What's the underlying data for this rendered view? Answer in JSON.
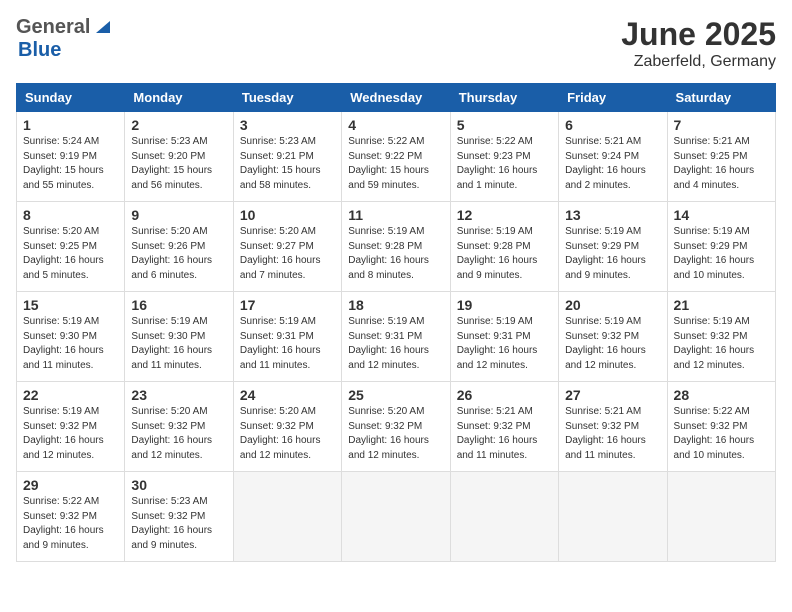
{
  "logo": {
    "general": "General",
    "blue": "Blue"
  },
  "title": "June 2025",
  "subtitle": "Zaberfeld, Germany",
  "days": [
    "Sunday",
    "Monday",
    "Tuesday",
    "Wednesday",
    "Thursday",
    "Friday",
    "Saturday"
  ],
  "weeks": [
    [
      {
        "num": "1",
        "info": "Sunrise: 5:24 AM\nSunset: 9:19 PM\nDaylight: 15 hours\nand 55 minutes."
      },
      {
        "num": "2",
        "info": "Sunrise: 5:23 AM\nSunset: 9:20 PM\nDaylight: 15 hours\nand 56 minutes."
      },
      {
        "num": "3",
        "info": "Sunrise: 5:23 AM\nSunset: 9:21 PM\nDaylight: 15 hours\nand 58 minutes."
      },
      {
        "num": "4",
        "info": "Sunrise: 5:22 AM\nSunset: 9:22 PM\nDaylight: 15 hours\nand 59 minutes."
      },
      {
        "num": "5",
        "info": "Sunrise: 5:22 AM\nSunset: 9:23 PM\nDaylight: 16 hours\nand 1 minute."
      },
      {
        "num": "6",
        "info": "Sunrise: 5:21 AM\nSunset: 9:24 PM\nDaylight: 16 hours\nand 2 minutes."
      },
      {
        "num": "7",
        "info": "Sunrise: 5:21 AM\nSunset: 9:25 PM\nDaylight: 16 hours\nand 4 minutes."
      }
    ],
    [
      {
        "num": "8",
        "info": "Sunrise: 5:20 AM\nSunset: 9:25 PM\nDaylight: 16 hours\nand 5 minutes."
      },
      {
        "num": "9",
        "info": "Sunrise: 5:20 AM\nSunset: 9:26 PM\nDaylight: 16 hours\nand 6 minutes."
      },
      {
        "num": "10",
        "info": "Sunrise: 5:20 AM\nSunset: 9:27 PM\nDaylight: 16 hours\nand 7 minutes."
      },
      {
        "num": "11",
        "info": "Sunrise: 5:19 AM\nSunset: 9:28 PM\nDaylight: 16 hours\nand 8 minutes."
      },
      {
        "num": "12",
        "info": "Sunrise: 5:19 AM\nSunset: 9:28 PM\nDaylight: 16 hours\nand 9 minutes."
      },
      {
        "num": "13",
        "info": "Sunrise: 5:19 AM\nSunset: 9:29 PM\nDaylight: 16 hours\nand 9 minutes."
      },
      {
        "num": "14",
        "info": "Sunrise: 5:19 AM\nSunset: 9:29 PM\nDaylight: 16 hours\nand 10 minutes."
      }
    ],
    [
      {
        "num": "15",
        "info": "Sunrise: 5:19 AM\nSunset: 9:30 PM\nDaylight: 16 hours\nand 11 minutes."
      },
      {
        "num": "16",
        "info": "Sunrise: 5:19 AM\nSunset: 9:30 PM\nDaylight: 16 hours\nand 11 minutes."
      },
      {
        "num": "17",
        "info": "Sunrise: 5:19 AM\nSunset: 9:31 PM\nDaylight: 16 hours\nand 11 minutes."
      },
      {
        "num": "18",
        "info": "Sunrise: 5:19 AM\nSunset: 9:31 PM\nDaylight: 16 hours\nand 12 minutes."
      },
      {
        "num": "19",
        "info": "Sunrise: 5:19 AM\nSunset: 9:31 PM\nDaylight: 16 hours\nand 12 minutes."
      },
      {
        "num": "20",
        "info": "Sunrise: 5:19 AM\nSunset: 9:32 PM\nDaylight: 16 hours\nand 12 minutes."
      },
      {
        "num": "21",
        "info": "Sunrise: 5:19 AM\nSunset: 9:32 PM\nDaylight: 16 hours\nand 12 minutes."
      }
    ],
    [
      {
        "num": "22",
        "info": "Sunrise: 5:19 AM\nSunset: 9:32 PM\nDaylight: 16 hours\nand 12 minutes."
      },
      {
        "num": "23",
        "info": "Sunrise: 5:20 AM\nSunset: 9:32 PM\nDaylight: 16 hours\nand 12 minutes."
      },
      {
        "num": "24",
        "info": "Sunrise: 5:20 AM\nSunset: 9:32 PM\nDaylight: 16 hours\nand 12 minutes."
      },
      {
        "num": "25",
        "info": "Sunrise: 5:20 AM\nSunset: 9:32 PM\nDaylight: 16 hours\nand 12 minutes."
      },
      {
        "num": "26",
        "info": "Sunrise: 5:21 AM\nSunset: 9:32 PM\nDaylight: 16 hours\nand 11 minutes."
      },
      {
        "num": "27",
        "info": "Sunrise: 5:21 AM\nSunset: 9:32 PM\nDaylight: 16 hours\nand 11 minutes."
      },
      {
        "num": "28",
        "info": "Sunrise: 5:22 AM\nSunset: 9:32 PM\nDaylight: 16 hours\nand 10 minutes."
      }
    ],
    [
      {
        "num": "29",
        "info": "Sunrise: 5:22 AM\nSunset: 9:32 PM\nDaylight: 16 hours\nand 9 minutes."
      },
      {
        "num": "30",
        "info": "Sunrise: 5:23 AM\nSunset: 9:32 PM\nDaylight: 16 hours\nand 9 minutes."
      },
      {
        "num": "",
        "info": ""
      },
      {
        "num": "",
        "info": ""
      },
      {
        "num": "",
        "info": ""
      },
      {
        "num": "",
        "info": ""
      },
      {
        "num": "",
        "info": ""
      }
    ]
  ]
}
